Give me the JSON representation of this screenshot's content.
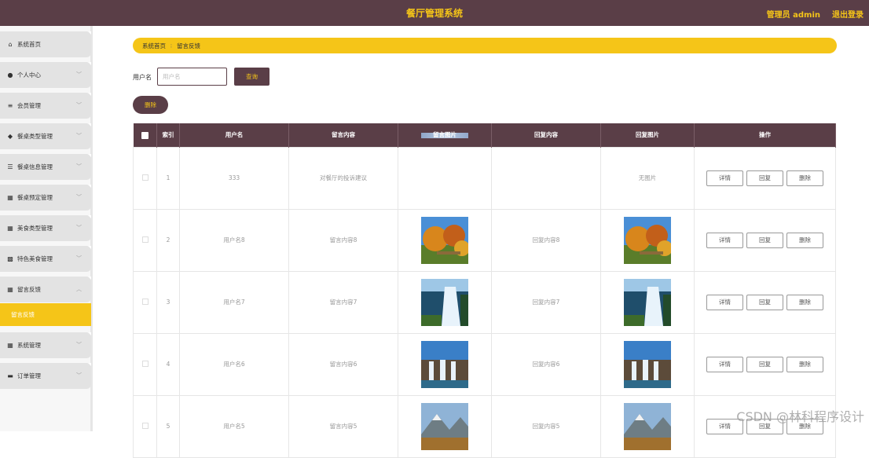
{
  "header": {
    "title": "餐厅管理系统",
    "admin": "管理员 admin",
    "logout": "退出登录"
  },
  "sidebar": {
    "items": [
      {
        "label": "系统首页",
        "icon": "home-icon",
        "chevron": false
      },
      {
        "label": "个人中心",
        "icon": "person-icon",
        "chevron": true
      },
      {
        "label": "会员管理",
        "icon": "list-icon",
        "chevron": true
      },
      {
        "label": "餐桌类型管理",
        "icon": "pin-icon",
        "chevron": true
      },
      {
        "label": "餐桌信息管理",
        "icon": "sliders-icon",
        "chevron": true
      },
      {
        "label": "餐桌预定管理",
        "icon": "grid-icon",
        "chevron": true
      },
      {
        "label": "美食类型管理",
        "icon": "grid-icon",
        "chevron": true
      },
      {
        "label": "特色美食管理",
        "icon": "apps-icon",
        "chevron": true
      },
      {
        "label": "留言反馈",
        "icon": "grid-icon",
        "chevron": true,
        "expanded": true
      },
      {
        "label": "系统管理",
        "icon": "grid-icon",
        "chevron": true
      },
      {
        "label": "订单管理",
        "icon": "bus-icon",
        "chevron": true
      }
    ],
    "submenu": "留言反馈"
  },
  "breadcrumb": {
    "home": "系统首页",
    "sep": "∶",
    "current": "留言反馈"
  },
  "search": {
    "label": "用户名",
    "placeholder": "用户名",
    "button": "查询"
  },
  "toolbar": {
    "delete": "删除"
  },
  "table": {
    "columns": [
      "",
      "索引",
      "用户名",
      "留言内容",
      "留言图片",
      "回复内容",
      "回复图片",
      "操作"
    ],
    "rows": [
      {
        "index": "1",
        "username": "333",
        "content": "对餐厅的投诉建议",
        "image": "strip",
        "reply": "",
        "reply_image": "none",
        "no_image_text": "无图片"
      },
      {
        "index": "2",
        "username": "用户名8",
        "content": "留言内容8",
        "image": "autumn",
        "reply": "回复内容8",
        "reply_image": "autumn"
      },
      {
        "index": "3",
        "username": "用户名7",
        "content": "留言内容7",
        "image": "waterfall",
        "reply": "回复内容7",
        "reply_image": "waterfall"
      },
      {
        "index": "4",
        "username": "用户名6",
        "content": "留言内容6",
        "image": "falls",
        "reply": "回复内容6",
        "reply_image": "falls"
      },
      {
        "index": "5",
        "username": "用户名5",
        "content": "留言内容5",
        "image": "mountain",
        "reply": "回复内容5",
        "reply_image": "mountain"
      }
    ],
    "actions": {
      "detail": "详情",
      "reply": "回复",
      "delete": "删除"
    }
  },
  "watermark": "CSDN @林科程序设计",
  "colors": {
    "primary": "#5a3e47",
    "accent": "#f5c518"
  }
}
